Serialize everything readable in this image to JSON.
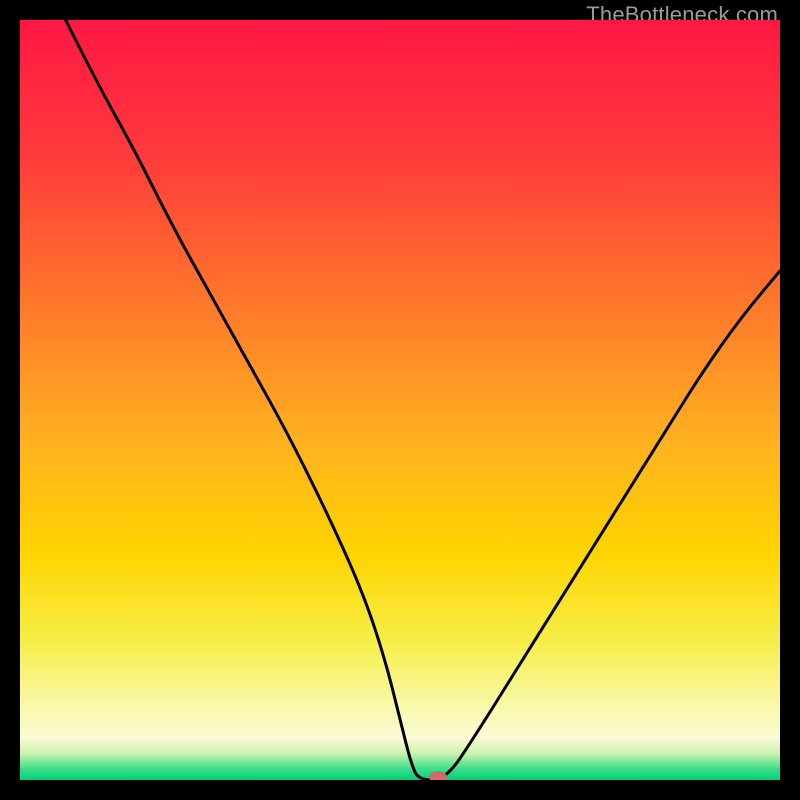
{
  "watermark": "TheBottleneck.com",
  "chart_data": {
    "type": "line",
    "title": "",
    "xlabel": "",
    "ylabel": "",
    "xlim": [
      0,
      100
    ],
    "ylim": [
      0,
      100
    ],
    "grid": false,
    "legend": false,
    "background_gradient_stops": [
      {
        "offset": 0.0,
        "color": "#ff1744"
      },
      {
        "offset": 0.18,
        "color": "#ff3b3b"
      },
      {
        "offset": 0.38,
        "color": "#ff7a2a"
      },
      {
        "offset": 0.55,
        "color": "#ffb020"
      },
      {
        "offset": 0.7,
        "color": "#ffd400"
      },
      {
        "offset": 0.82,
        "color": "#f6ef4a"
      },
      {
        "offset": 0.9,
        "color": "#f9f9a8"
      },
      {
        "offset": 0.945,
        "color": "#fbfbd6"
      },
      {
        "offset": 0.965,
        "color": "#c9f3b0"
      },
      {
        "offset": 0.985,
        "color": "#3fe08a"
      },
      {
        "offset": 1.0,
        "color": "#00d07a"
      }
    ],
    "series": [
      {
        "name": "left-branch",
        "x": [
          6,
          10,
          15,
          20,
          25,
          30,
          35,
          40,
          45,
          48,
          50,
          51.5,
          52.5
        ],
        "y": [
          100,
          92,
          83,
          73,
          64,
          55,
          46,
          36,
          25,
          16,
          8,
          2,
          0
        ]
      },
      {
        "name": "valley-flat",
        "x": [
          52.5,
          56
        ],
        "y": [
          0,
          0
        ]
      },
      {
        "name": "right-branch",
        "x": [
          56,
          60,
          65,
          70,
          75,
          80,
          85,
          90,
          95,
          100
        ],
        "y": [
          0,
          6,
          14,
          22,
          30,
          38,
          46,
          54,
          61,
          67
        ]
      }
    ],
    "marker": {
      "name": "selected-point",
      "x": 55,
      "y": 0,
      "color": "#d26a6a",
      "rx": 9,
      "ry": 6
    }
  }
}
